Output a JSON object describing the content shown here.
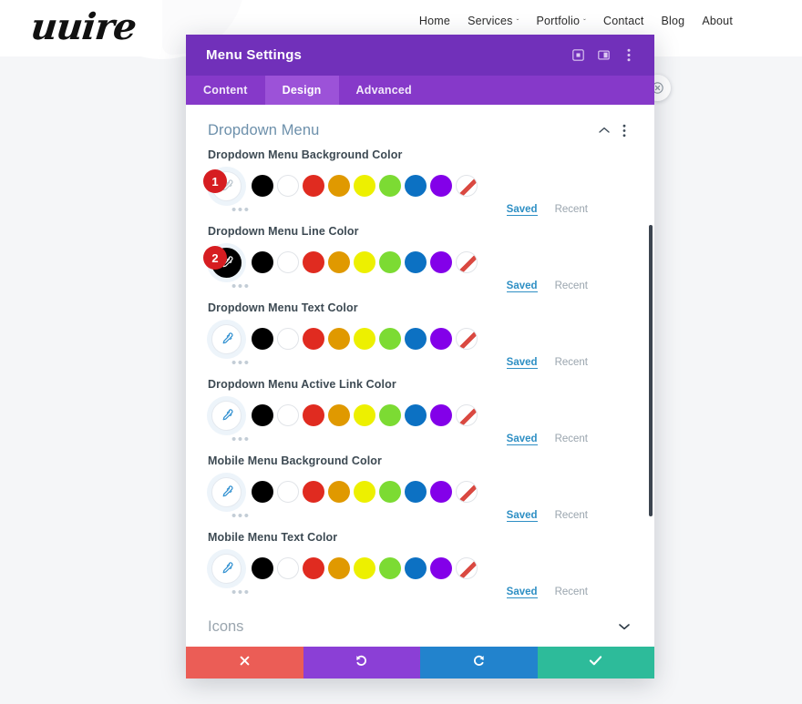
{
  "site": {
    "logo_text": "uuire",
    "nav": [
      {
        "label": "Home",
        "has_dropdown": false
      },
      {
        "label": "Services",
        "has_dropdown": true
      },
      {
        "label": "Portfolio",
        "has_dropdown": true
      },
      {
        "label": "Contact",
        "has_dropdown": false
      },
      {
        "label": "Blog",
        "has_dropdown": false
      },
      {
        "label": "About",
        "has_dropdown": false
      }
    ],
    "caret_glyph": "ˇ"
  },
  "modal": {
    "title": "Menu Settings",
    "titlebar_icons": [
      {
        "name": "expand-icon",
        "glyph": "⧉"
      },
      {
        "name": "layout-toggle-icon",
        "glyph": "◫"
      },
      {
        "name": "kebab-menu-icon",
        "glyph": "⋮"
      }
    ],
    "tabs": [
      {
        "label": "Content",
        "active": false
      },
      {
        "label": "Design",
        "active": true
      },
      {
        "label": "Advanced",
        "active": false
      }
    ],
    "section": {
      "title": "Dropdown Menu",
      "collapse_glyph": "˄",
      "kebab_glyph": "⋮"
    },
    "labels": {
      "saved": "Saved",
      "recent": "Recent",
      "ellipsis": "•••"
    },
    "palette": [
      {
        "name": "black",
        "hex": "#000000"
      },
      {
        "name": "white",
        "hex": "#ffffff"
      },
      {
        "name": "red",
        "hex": "#e02b20"
      },
      {
        "name": "orange",
        "hex": "#e09900"
      },
      {
        "name": "yellow",
        "hex": "#edf000"
      },
      {
        "name": "green",
        "hex": "#7cdb33"
      },
      {
        "name": "blue",
        "hex": "#0c71c3"
      },
      {
        "name": "purple",
        "hex": "#8300e9"
      },
      {
        "name": "transparent",
        "hex": "none"
      }
    ],
    "fields": [
      {
        "label": "Dropdown Menu Background Color",
        "badge": "1",
        "picker_state": "empty"
      },
      {
        "label": "Dropdown Menu Line Color",
        "badge": "2",
        "picker_state": "black"
      },
      {
        "label": "Dropdown Menu Text Color",
        "badge": "",
        "picker_state": "empty"
      },
      {
        "label": "Dropdown Menu Active Link Color",
        "badge": "",
        "picker_state": "empty"
      },
      {
        "label": "Mobile Menu Background Color",
        "badge": "",
        "picker_state": "empty"
      },
      {
        "label": "Mobile Menu Text Color",
        "badge": "",
        "picker_state": "empty"
      }
    ],
    "next_section": {
      "title": "Icons",
      "expand_glyph": "˅"
    },
    "footer_buttons": [
      {
        "name": "cancel-button",
        "glyph": "✖",
        "color": "#eb5d56"
      },
      {
        "name": "undo-button",
        "glyph": "↺",
        "color": "#8b3fd6"
      },
      {
        "name": "redo-button",
        "glyph": "↻",
        "color": "#2283cd"
      },
      {
        "name": "save-button",
        "glyph": "✔",
        "color": "#2dbb9a"
      }
    ]
  },
  "floating_button": {
    "name": "settings-circle-icon",
    "glyph": "✖"
  }
}
